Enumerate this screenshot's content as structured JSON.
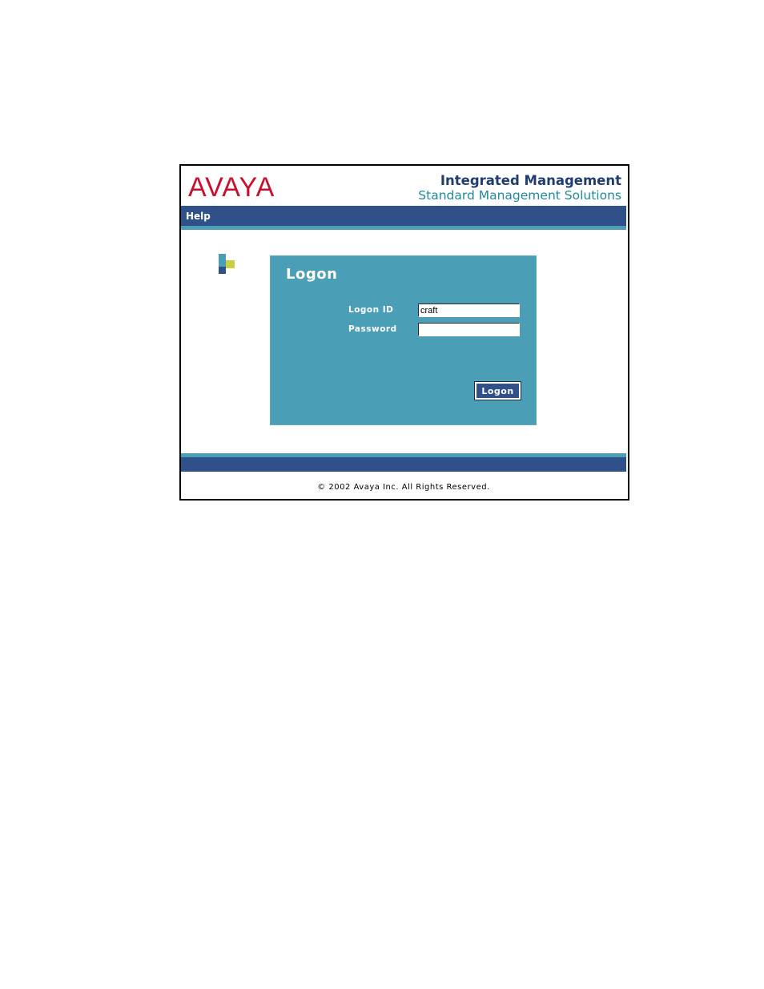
{
  "header": {
    "logo": "AVAYA",
    "title": "Integrated Management",
    "subtitle": "Standard Management Solutions"
  },
  "nav": {
    "help_label": "Help"
  },
  "logon_panel": {
    "title": "Logon",
    "logon_id_label": "Logon ID",
    "logon_id_value": "craft",
    "password_label": "Password",
    "password_value": "",
    "button_label": "Logon"
  },
  "footer": {
    "copyright": "© 2002 Avaya Inc. All Rights Reserved."
  },
  "colors": {
    "brand_red": "#c8102e",
    "navy": "#2f5089",
    "teal": "#4a9fb7",
    "accent_yellow": "#c9cf3f"
  }
}
